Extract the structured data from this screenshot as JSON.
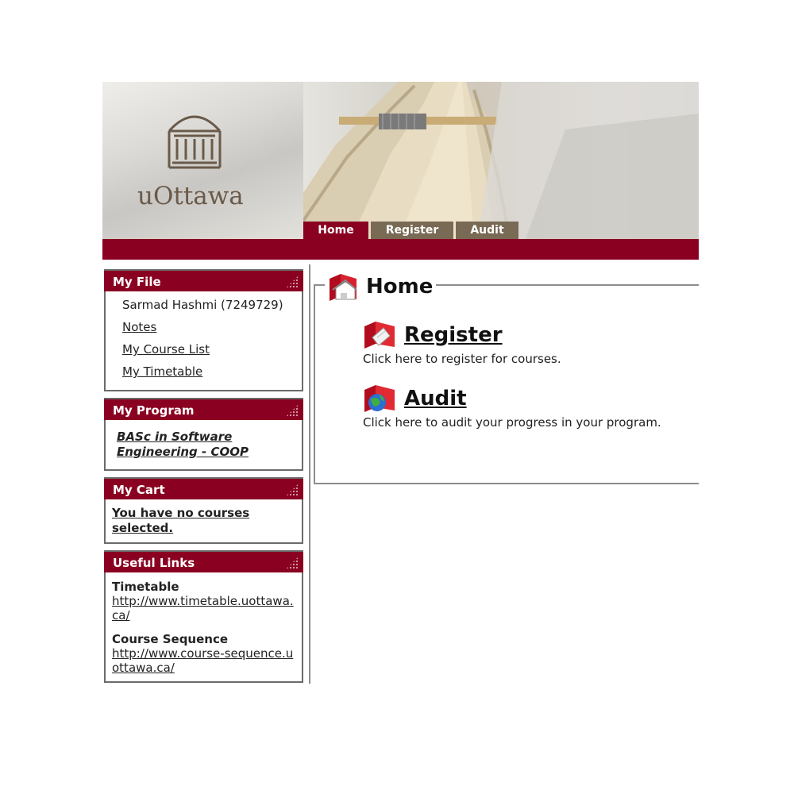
{
  "banner": {
    "logo_text": "uOttawa",
    "tabs": [
      {
        "label": "Home",
        "active": true
      },
      {
        "label": "Register",
        "active": false
      },
      {
        "label": "Audit",
        "active": false
      }
    ]
  },
  "colors": {
    "brand": "#8a0021",
    "tab_inactive": "#786a55",
    "border": "#6b6b6b"
  },
  "sidebar": {
    "my_file": {
      "title": "My File",
      "user": "Sarmad Hashmi (7249729)",
      "links": [
        "Notes",
        "My Course List",
        "My Timetable"
      ]
    },
    "my_program": {
      "title": "My Program",
      "program": "BASc in Software Engineering - COOP"
    },
    "my_cart": {
      "title": "My Cart",
      "message": "You have no courses selected."
    },
    "useful_links": {
      "title": "Useful Links",
      "items": [
        {
          "title": "Timetable",
          "url": "http://www.timetable.uottawa.ca/"
        },
        {
          "title": "Course Sequence",
          "url": "http://www.course-sequence.uottawa.ca/"
        }
      ]
    }
  },
  "main": {
    "heading": "Home",
    "items": [
      {
        "title": "Register",
        "description": "Click here to register for courses.",
        "icon": "folder-register-icon"
      },
      {
        "title": "Audit",
        "description": "Click here to audit your progress in your program.",
        "icon": "folder-globe-icon"
      }
    ]
  }
}
